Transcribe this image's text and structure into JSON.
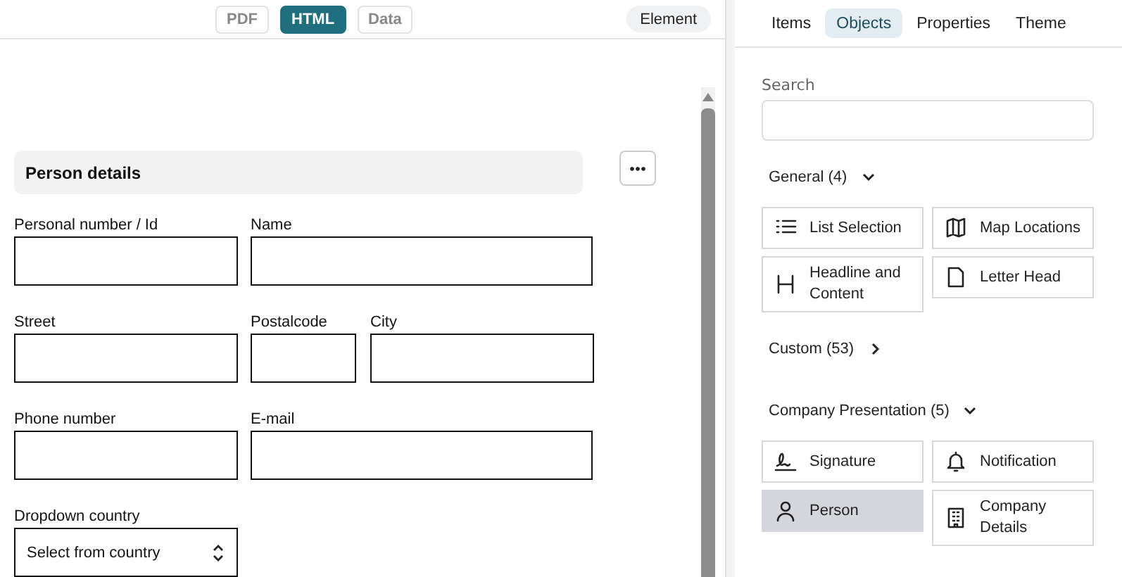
{
  "toolbar": {
    "view_tabs": [
      {
        "label": "PDF",
        "selected": false
      },
      {
        "label": "HTML",
        "selected": true
      },
      {
        "label": "Data",
        "selected": false
      }
    ],
    "element_button": "Element"
  },
  "form": {
    "section_title": "Person details",
    "rows": [
      [
        {
          "label": "Personal number / Id",
          "kind": "text"
        },
        {
          "label": "Name",
          "kind": "text"
        }
      ],
      [
        {
          "label": "Street",
          "kind": "text"
        },
        {
          "label": "Postalcode",
          "kind": "text"
        },
        {
          "label": "City",
          "kind": "text"
        }
      ],
      [
        {
          "label": "Phone number",
          "kind": "text"
        },
        {
          "label": "E-mail",
          "kind": "text"
        }
      ],
      [
        {
          "label": "Dropdown country",
          "kind": "select",
          "value": "Select from country"
        }
      ]
    ]
  },
  "panel": {
    "tabs": [
      {
        "label": "Items",
        "selected": false
      },
      {
        "label": "Objects",
        "selected": true
      },
      {
        "label": "Properties",
        "selected": false
      },
      {
        "label": "Theme",
        "selected": false
      }
    ],
    "search": {
      "label": "Search"
    },
    "sections": [
      {
        "title": "General (4)",
        "expanded": true,
        "items": [
          {
            "label": "List Selection",
            "kind": "list",
            "selected": false
          },
          {
            "label": "Map Locations",
            "kind": "map",
            "selected": false
          },
          {
            "label": "Headline and Content",
            "kind": "heading",
            "selected": false
          },
          {
            "label": "Letter Head",
            "kind": "page",
            "selected": false
          }
        ]
      },
      {
        "title": "Custom (53)",
        "expanded": false
      },
      {
        "title": "Company Presentation (5)",
        "expanded": true,
        "items": [
          {
            "label": "Signature",
            "kind": "signature",
            "selected": false
          },
          {
            "label": "Notification",
            "kind": "bell",
            "selected": false
          },
          {
            "label": "Person",
            "kind": "person",
            "selected": true
          },
          {
            "label": "Company Details",
            "kind": "building",
            "selected": false
          }
        ]
      }
    ]
  }
}
